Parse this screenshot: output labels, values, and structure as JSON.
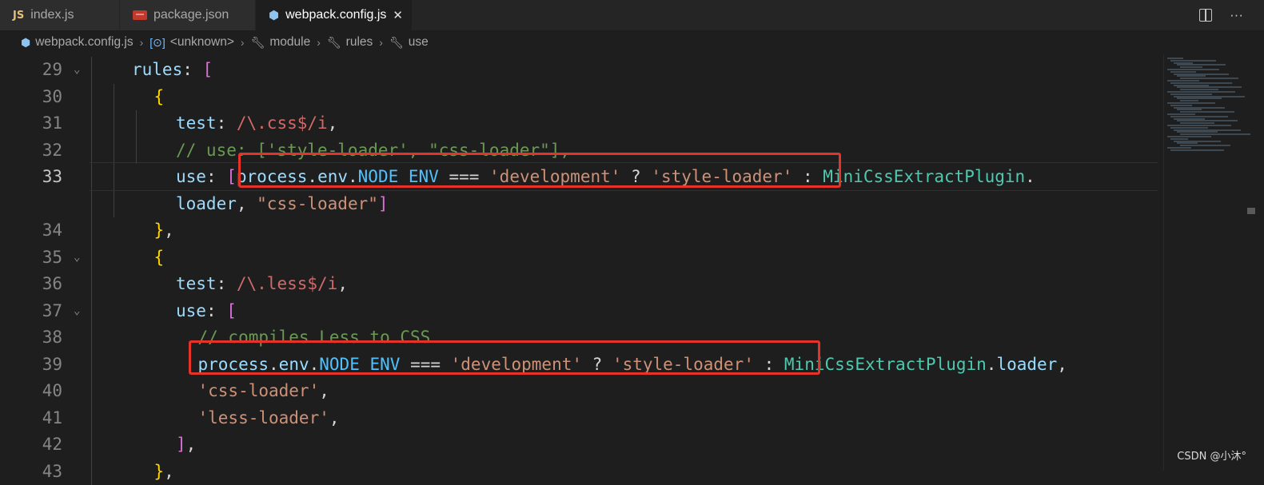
{
  "tabs": [
    {
      "icon": "JS",
      "label": "index.js"
    },
    {
      "icon": "npm",
      "label": "package.json"
    },
    {
      "icon": "webpack",
      "label": "webpack.config.js",
      "close": "✕"
    }
  ],
  "breadcrumb": {
    "file": "webpack.config.js",
    "items": [
      "<unknown>",
      "module",
      "rules",
      "use"
    ]
  },
  "lines": [
    {
      "n": "29",
      "tokens": [
        [
          "k",
          "rules"
        ],
        [
          "p",
          ": "
        ],
        [
          "b2",
          "["
        ]
      ]
    },
    {
      "n": "30",
      "tokens": [
        [
          "b1",
          "{"
        ]
      ]
    },
    {
      "n": "31",
      "tokens": [
        [
          "k",
          "test"
        ],
        [
          "p",
          ": "
        ],
        [
          "re",
          "/\\.css$/i"
        ],
        [
          "p",
          ","
        ]
      ]
    },
    {
      "n": "32",
      "tokens": [
        [
          "c",
          "// use: ['style-loader', \"css-loader\"],"
        ]
      ]
    },
    {
      "n": "33",
      "tokens": [
        [
          "k",
          "use"
        ],
        [
          "p",
          ": "
        ],
        [
          "b2",
          "["
        ],
        [
          "k",
          "process"
        ],
        [
          "p",
          "."
        ],
        [
          "k",
          "env"
        ],
        [
          "p",
          "."
        ],
        [
          "const",
          "NODE_ENV"
        ],
        [
          "p",
          " === "
        ],
        [
          "s",
          "'development'"
        ],
        [
          "p",
          " ? "
        ],
        [
          "s",
          "'style-loader'"
        ],
        [
          "p",
          " : "
        ],
        [
          "cls",
          "MiniCssExtractPlugin"
        ],
        [
          "p",
          "."
        ]
      ]
    },
    {
      "n": "",
      "tokens": [
        [
          "k",
          "loader"
        ],
        [
          "p",
          ", "
        ],
        [
          "s",
          "\"css-loader\""
        ],
        [
          "b2",
          "]"
        ]
      ]
    },
    {
      "n": "34",
      "tokens": [
        [
          "b1",
          "}"
        ],
        [
          "p",
          ","
        ]
      ]
    },
    {
      "n": "35",
      "tokens": [
        [
          "b1",
          "{"
        ]
      ]
    },
    {
      "n": "36",
      "tokens": [
        [
          "k",
          "test"
        ],
        [
          "p",
          ": "
        ],
        [
          "re",
          "/\\.less$/i"
        ],
        [
          "p",
          ","
        ]
      ]
    },
    {
      "n": "37",
      "tokens": [
        [
          "k",
          "use"
        ],
        [
          "p",
          ": "
        ],
        [
          "b2",
          "["
        ]
      ]
    },
    {
      "n": "38",
      "tokens": [
        [
          "c",
          "// compiles Less to CSS"
        ]
      ]
    },
    {
      "n": "39",
      "tokens": [
        [
          "k",
          "process"
        ],
        [
          "p",
          "."
        ],
        [
          "k",
          "env"
        ],
        [
          "p",
          "."
        ],
        [
          "const",
          "NODE_ENV"
        ],
        [
          "p",
          " === "
        ],
        [
          "s",
          "'development'"
        ],
        [
          "p",
          " ? "
        ],
        [
          "s",
          "'style-loader'"
        ],
        [
          "p",
          " : "
        ],
        [
          "cls",
          "MiniCssExtractPlugin"
        ],
        [
          "p",
          "."
        ],
        [
          "k",
          "loader"
        ],
        [
          "p",
          ","
        ]
      ]
    },
    {
      "n": "40",
      "tokens": [
        [
          "s",
          "'css-loader'"
        ],
        [
          "p",
          ","
        ]
      ]
    },
    {
      "n": "41",
      "tokens": [
        [
          "s",
          "'less-loader'"
        ],
        [
          "p",
          ","
        ]
      ]
    },
    {
      "n": "42",
      "tokens": [
        [
          "b2",
          "]"
        ],
        [
          "p",
          ","
        ]
      ]
    },
    {
      "n": "43",
      "tokens": [
        [
          "b1",
          "}"
        ],
        [
          "p",
          ","
        ]
      ]
    }
  ],
  "watermark": "CSDN @小沐°"
}
